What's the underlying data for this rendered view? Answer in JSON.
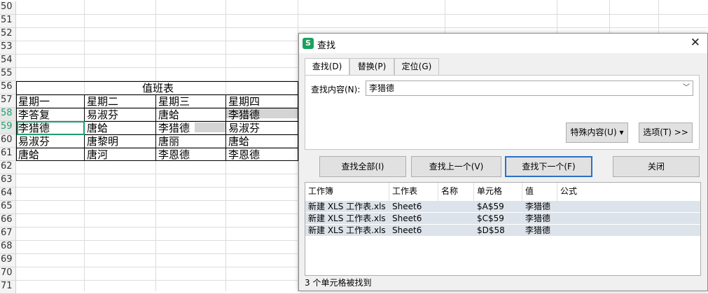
{
  "sheet": {
    "row_numbers": [
      "50",
      "51",
      "52",
      "53",
      "54",
      "55",
      "56",
      "57",
      "58",
      "59",
      "60",
      "61",
      "62",
      "63",
      "64",
      "65",
      "66",
      "67",
      "68",
      "69",
      "70",
      "71"
    ],
    "selected_rows": [
      "58",
      "59"
    ],
    "table_title": "值班表",
    "headers": [
      "星期一",
      "星期二",
      "星期三",
      "星期四"
    ],
    "rows": [
      [
        "李答复",
        "易淑芬",
        "唐蛤",
        "李猎德"
      ],
      [
        "李猎德",
        "唐蛤",
        "李猎德",
        "易淑芬"
      ],
      [
        "易淑芬",
        "唐黎明",
        "唐丽",
        "唐蛤"
      ],
      [
        "唐蛤",
        "唐河",
        "李恩德",
        "李恩德"
      ]
    ]
  },
  "dialog": {
    "title": "查找",
    "close_icon": "close-icon",
    "tabs": [
      "查找(D)",
      "替换(P)",
      "定位(G)"
    ],
    "find_label": "查找内容(N):",
    "find_value": "李猎德",
    "special_button": "特殊内容(U) ▾",
    "options_button": "选项(T) >>",
    "find_all": "查找全部(I)",
    "find_prev": "查找上一个(V)",
    "find_next": "查找下一个(F)",
    "close": "关闭",
    "columns": [
      "工作簿",
      "工作表",
      "名称",
      "单元格",
      "值",
      "公式"
    ],
    "results": [
      [
        "新建 XLS 工作表.xls",
        "Sheet6",
        "",
        "$A$59",
        "李猎德",
        ""
      ],
      [
        "新建 XLS 工作表.xls",
        "Sheet6",
        "",
        "$C$59",
        "李猎德",
        ""
      ],
      [
        "新建 XLS 工作表.xls",
        "Sheet6",
        "",
        "$D$58",
        "李猎德",
        ""
      ]
    ],
    "status": "3 个单元格被找到"
  }
}
